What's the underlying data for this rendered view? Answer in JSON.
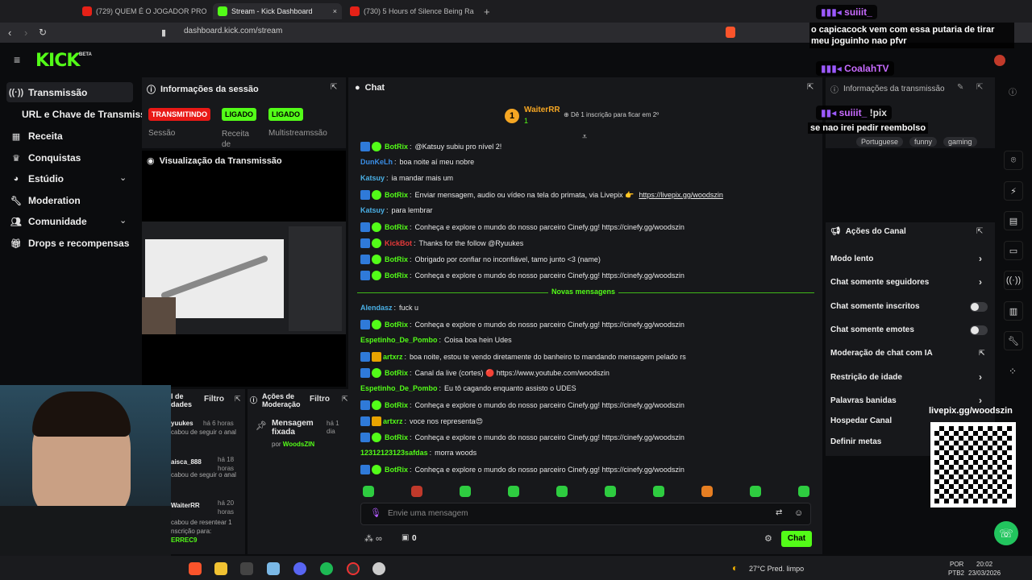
{
  "browser": {
    "tabs": [
      {
        "label": "(729) QUEM É O JOGADOR PROFISSIO",
        "color": "#e62117"
      },
      {
        "label": "Stream - Kick Dashboard",
        "color": "#53fc18"
      },
      {
        "label": "(730) 5 Hours of Silence Being Rando",
        "color": "#e62117"
      }
    ],
    "new_tab_symbol": "+",
    "close_symbol": "×",
    "url": "dashboard.kick.com/stream"
  },
  "topbar": {
    "logo": "KICK",
    "beta": "BETA"
  },
  "sidebar": {
    "items": [
      {
        "label": "Transmissão",
        "icon": "broadcast-icon"
      },
      {
        "label": "URL e Chave de Transmissão",
        "icon": ""
      },
      {
        "label": "Receita",
        "icon": "receipt-icon"
      },
      {
        "label": "Conquistas",
        "icon": "trophy-icon"
      },
      {
        "label": "Estúdio",
        "icon": "palette-icon"
      },
      {
        "label": "Moderation",
        "icon": "wrench-icon"
      },
      {
        "label": "Comunidade",
        "icon": "people-icon"
      },
      {
        "label": "Drops e recompensas",
        "icon": "gift-icon"
      }
    ]
  },
  "session": {
    "title": "Informações da sessão",
    "badges": [
      {
        "label": "TRANSMITINDO",
        "sub": "Sessão",
        "color": "#e91916"
      },
      {
        "label": "LIGADO",
        "sub": "Receita de",
        "color": "#53fc18"
      },
      {
        "label": "LIGADO",
        "sub": "Multistreamssão",
        "color": "#53fc18"
      }
    ]
  },
  "preview": {
    "title": "Visualização da Transmissão"
  },
  "activity": {
    "title": "l de dades",
    "filter": "Filtro",
    "entries": [
      {
        "user": "yuukes",
        "time": "há 6 horas",
        "text": "cabou de seguir o anal"
      },
      {
        "user": "aisca_888",
        "time": "há 18 horas",
        "text": "cabou de seguir o anal"
      },
      {
        "user": "WaiterRR",
        "time": "há 20 horas",
        "text": "cabou de resentear 1 nscrição para:",
        "extra": "ERREC9"
      }
    ]
  },
  "modactions": {
    "title": "Ações de Moderação",
    "filter": "Filtro",
    "pinned": "Mensagem fixada",
    "time": "há 1 dia",
    "by_label": "por",
    "by_user": "WoodsZIN"
  },
  "chat": {
    "title": "Chat",
    "top_gifter": {
      "rank": "1",
      "name": "WaiterRR",
      "count": "1",
      "note": "Dê 1 inscrição para ficar em 2º"
    },
    "messages": [
      {
        "user": "BotRix",
        "color": "#53fc18",
        "badges": [
          "b1",
          "b2"
        ],
        "text": "@Katsuy subiu pro nível 2!"
      },
      {
        "user": "DunKeLh",
        "color": "#3a8ee6",
        "badges": [],
        "text": "boa noite aí meu nobre"
      },
      {
        "user": "Katsuy",
        "color": "#4ab0e6",
        "badges": [],
        "text": "ia mandar mais um"
      },
      {
        "user": "BotRix",
        "color": "#53fc18",
        "badges": [
          "b1",
          "b2"
        ],
        "text": "Enviar mensagem, audio ou vídeo na tela do primata, via Livepix 👉",
        "link": "https://livepix.gg/woodszin"
      },
      {
        "user": "Katsuy",
        "color": "#4ab0e6",
        "badges": [],
        "text": "para lembrar"
      },
      {
        "user": "BotRix",
        "color": "#53fc18",
        "badges": [
          "b1",
          "b2"
        ],
        "text": "Conheça e explore o mundo do nosso parceiro Cinefy.gg! https://cinefy.gg/woodszin"
      },
      {
        "user": "KickBot",
        "color": "#e63939",
        "badges": [
          "b1",
          "b2"
        ],
        "text": "Thanks for the follow @Ryuukes"
      },
      {
        "user": "BotRix",
        "color": "#53fc18",
        "badges": [
          "b1",
          "b2"
        ],
        "text": "Obrigado por confiar no inconfiável, tamo junto <3 (name)"
      },
      {
        "user": "BotRix",
        "color": "#53fc18",
        "badges": [
          "b1",
          "b2"
        ],
        "text": "Conheça e explore o mundo do nosso parceiro Cinefy.gg! https://cinefy.gg/woodszin"
      }
    ],
    "new_messages": "Novas mensagens",
    "messages2": [
      {
        "user": "Alendasz",
        "color": "#4ab0e6",
        "badges": [],
        "text": "fuck u"
      },
      {
        "user": "BotRix",
        "color": "#53fc18",
        "badges": [
          "b1",
          "b2"
        ],
        "text": "Conheça e explore o mundo do nosso parceiro Cinefy.gg! https://cinefy.gg/woodszin"
      },
      {
        "user": "Espetinho_De_Pombo",
        "color": "#53fc18",
        "badges": [],
        "text": "Coisa boa hein Udes"
      },
      {
        "user": "artxrz",
        "color": "#53fc18",
        "badges": [
          "b1",
          "b3"
        ],
        "text": "boa noite, estou te vendo diretamente do banheiro to mandando mensagem pelado rs"
      },
      {
        "user": "BotRix",
        "color": "#53fc18",
        "badges": [
          "b1",
          "b2"
        ],
        "text": "Canal da live (cortes) 🔴 https://www.youtube.com/woodszin"
      },
      {
        "user": "Espetinho_De_Pombo",
        "color": "#53fc18",
        "badges": [],
        "text": "Eu tô cagando enquanto assisto o UDES"
      },
      {
        "user": "BotRix",
        "color": "#53fc18",
        "badges": [
          "b1",
          "b2"
        ],
        "text": "Conheça e explore o mundo do nosso parceiro Cinefy.gg! https://cinefy.gg/woodszin"
      },
      {
        "user": "artxrz",
        "color": "#53fc18",
        "badges": [
          "b1",
          "b3"
        ],
        "text": "voce nos representa😍"
      },
      {
        "user": "BotRix",
        "color": "#53fc18",
        "badges": [
          "b1",
          "b2"
        ],
        "text": "Conheça e explore o mundo do nosso parceiro Cinefy.gg! https://cinefy.gg/woodszin"
      },
      {
        "user": "12312123123safdas",
        "color": "#53fc18",
        "badges": [],
        "text": "morra woods"
      },
      {
        "user": "BotRix",
        "color": "#53fc18",
        "badges": [
          "b1",
          "b2"
        ],
        "text": "Conheça e explore o mundo do nosso parceiro Cinefy.gg! https://cinefy.gg/woodszin"
      }
    ],
    "input_placeholder": "Envie uma mensagem",
    "viewer_count": "0",
    "send_label": "Chat"
  },
  "stream_info": {
    "title": "Informações da transmissão",
    "tags": [
      "Portuguese",
      "funny",
      "gaming"
    ]
  },
  "channel_actions": {
    "title": "Ações do Canal",
    "items": [
      {
        "label": "Modo lento",
        "control": "chevron"
      },
      {
        "label": "Chat somente seguidores",
        "control": "chevron"
      },
      {
        "label": "Chat somente inscritos",
        "control": "toggle"
      },
      {
        "label": "Chat somente emotes",
        "control": "toggle"
      },
      {
        "label": "Moderação de chat com IA",
        "control": "external"
      },
      {
        "label": "Restrição de idade",
        "control": "chevron"
      },
      {
        "label": "Palavras banidas",
        "control": "chevron"
      },
      {
        "label": "Hospedar Canal",
        "control": ""
      },
      {
        "label": "Definir metas",
        "control": ""
      }
    ]
  },
  "overlay": {
    "messages": [
      {
        "user": "suiiit_",
        "text": "o capicacock vem com essa putaria de tirar meu joguinho nao pfvr"
      },
      {
        "user": "CoalahTV",
        "text": ""
      },
      {
        "user": "suiiit_",
        "text": "se nao irei pedir reembolso",
        "extra": "!pix"
      }
    ],
    "livepix": "livepix.gg/woodszin"
  },
  "taskbar": {
    "weather": "27°C  Pred. limpo",
    "lang1": "POR",
    "lang2": "PTB2",
    "time": "20:02",
    "date": "23/03/2026"
  }
}
